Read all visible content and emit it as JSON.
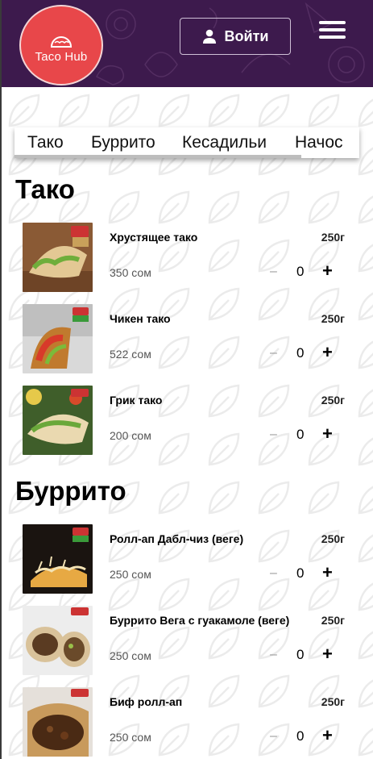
{
  "header": {
    "logo_text": "Taco Hub",
    "login_label": "Войти",
    "colors": {
      "header_bg": "#3d1a4d",
      "logo_bg": "#e8474a"
    }
  },
  "tabs": [
    {
      "label": "Тако"
    },
    {
      "label": "Буррито"
    },
    {
      "label": "Кесадильи"
    },
    {
      "label": "Начос"
    }
  ],
  "sections": [
    {
      "title": "Тако",
      "items": [
        {
          "name": "Хрустящее тако",
          "weight": "250г",
          "price": "350 сом",
          "qty": "0"
        },
        {
          "name": "Чикен тако",
          "weight": "250г",
          "price": "522 сом",
          "qty": "0"
        },
        {
          "name": "Грик тако",
          "weight": "250г",
          "price": "200 сом",
          "qty": "0"
        }
      ]
    },
    {
      "title": "Буррито",
      "items": [
        {
          "name": "Ролл-ап Дабл-чиз (веге)",
          "weight": "250г",
          "price": "250 сом",
          "qty": "0"
        },
        {
          "name": "Буррито Вега с гуакамоле (веге)",
          "weight": "250г",
          "price": "250 сом",
          "qty": "0"
        },
        {
          "name": "Биф ролл-ап",
          "weight": "250г",
          "price": "250 сом",
          "qty": "0"
        }
      ]
    }
  ],
  "controls": {
    "minus": "–",
    "plus": "+"
  }
}
